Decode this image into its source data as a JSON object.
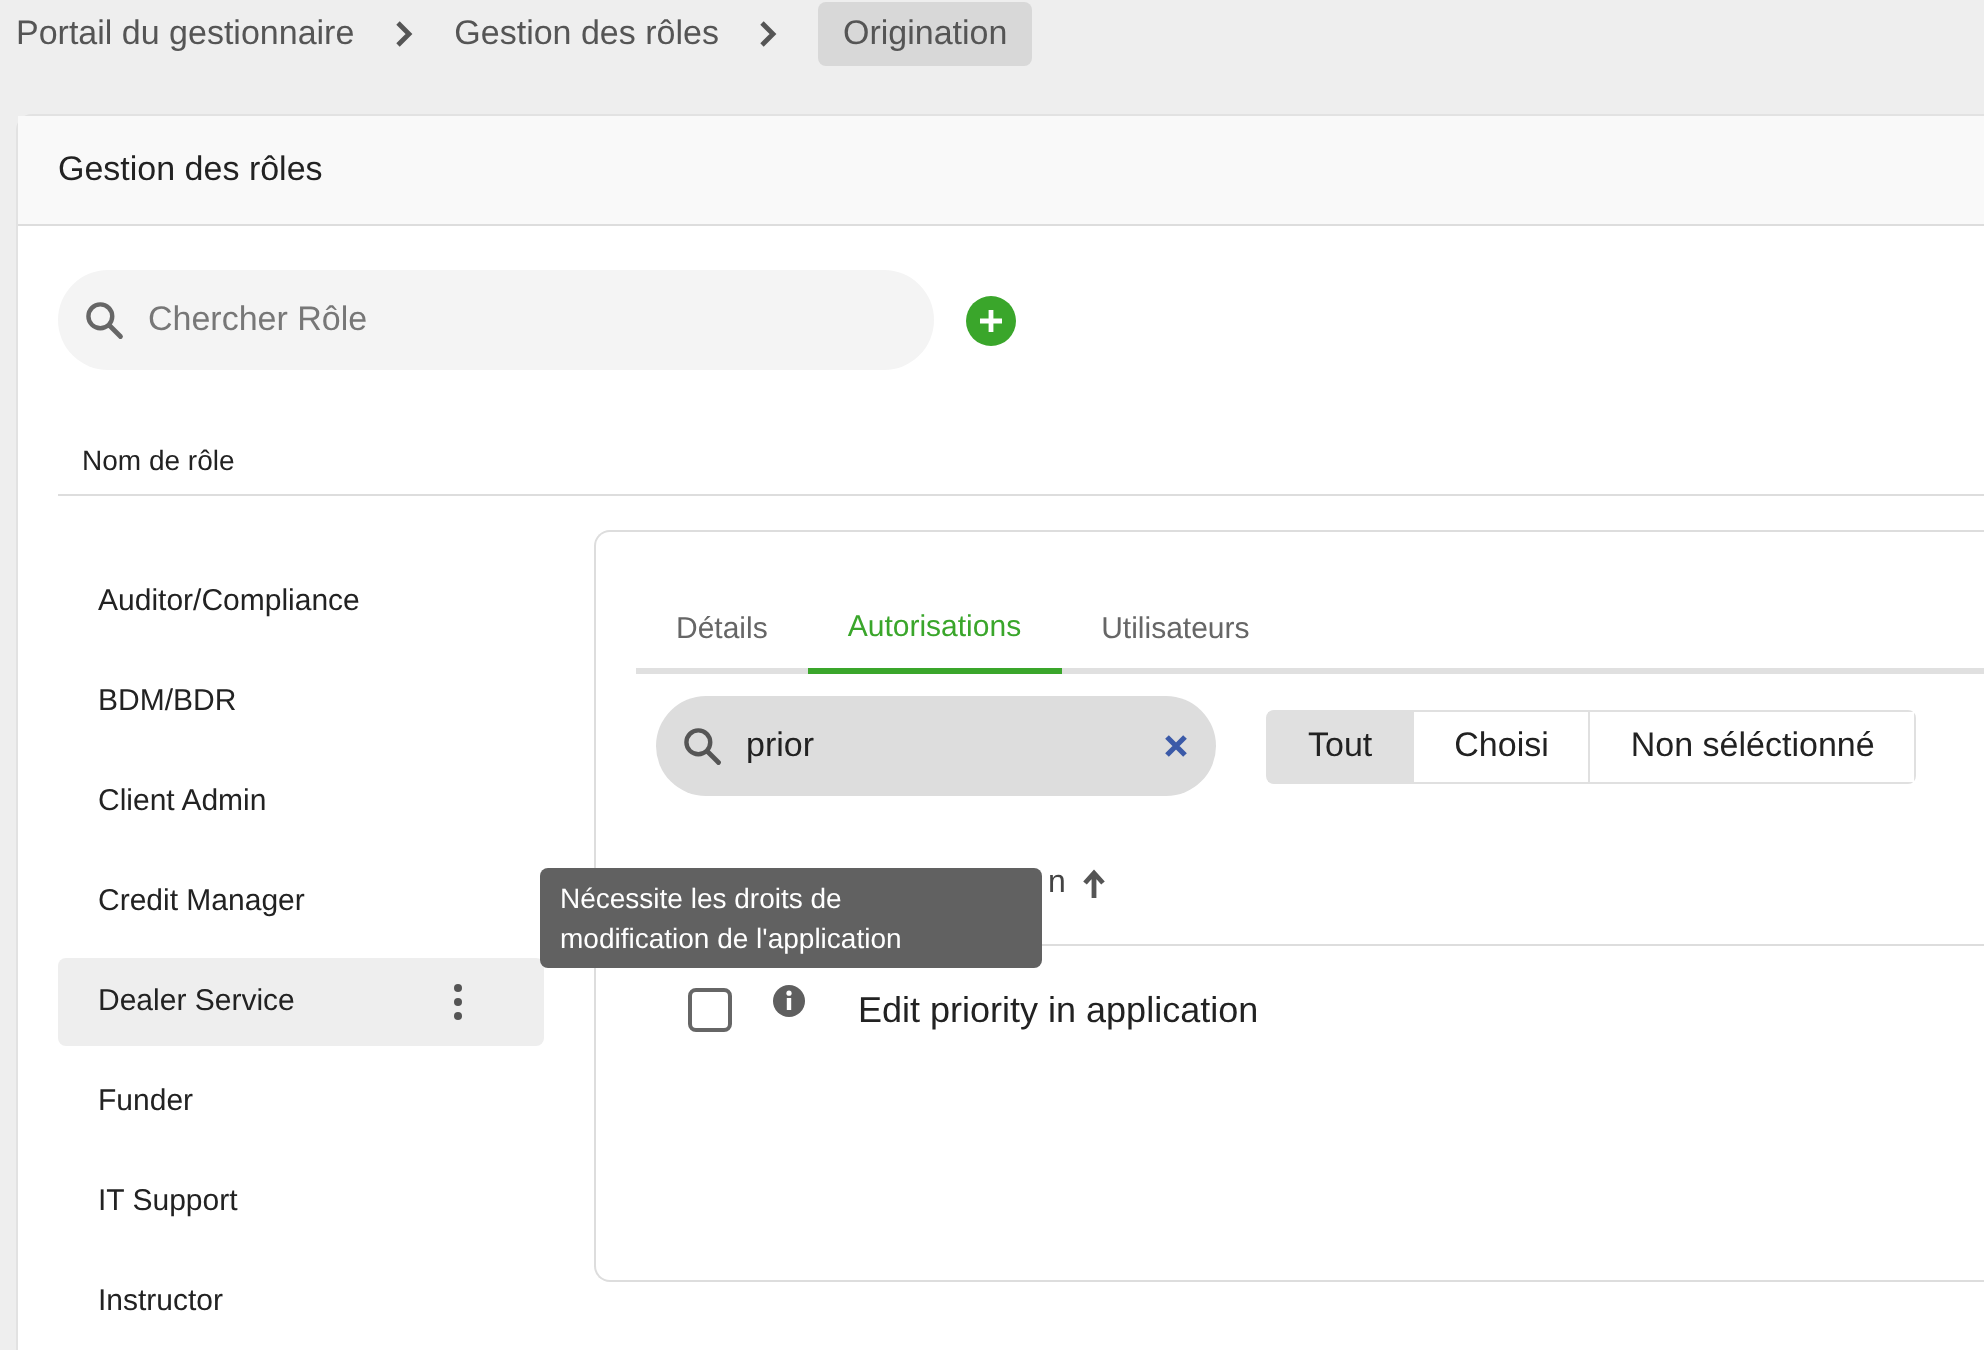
{
  "breadcrumb": [
    {
      "label": "Portail du gestionnaire",
      "selected": false
    },
    {
      "label": "Gestion des rôles",
      "selected": false
    },
    {
      "label": "Origination",
      "selected": true
    }
  ],
  "card": {
    "title": "Gestion des rôles"
  },
  "role_search": {
    "placeholder": "Chercher Rôle"
  },
  "roles_header": "Nom de rôle",
  "roles": [
    {
      "label": "Auditor/Compliance",
      "selected": false
    },
    {
      "label": "BDM/BDR",
      "selected": false
    },
    {
      "label": "Client Admin",
      "selected": false
    },
    {
      "label": "Credit Manager",
      "selected": false
    },
    {
      "label": "Dealer Service",
      "selected": true
    },
    {
      "label": "Funder",
      "selected": false
    },
    {
      "label": "IT Support",
      "selected": false
    },
    {
      "label": "Instructor",
      "selected": false
    }
  ],
  "tabs": [
    {
      "label": "Détails",
      "selected": false
    },
    {
      "label": "Autorisations",
      "selected": true
    },
    {
      "label": "Utilisateurs",
      "selected": false
    }
  ],
  "permission_search": {
    "value": "prior"
  },
  "filter": [
    {
      "label": "Tout",
      "selected": true
    },
    {
      "label": "Choisi",
      "selected": false
    },
    {
      "label": "Non séléctionné",
      "selected": false
    }
  ],
  "column_header": "n",
  "permissions": [
    {
      "label": "Edit priority in application",
      "checked": false
    }
  ],
  "tooltip": "Nécessite les droits de modification de l'application"
}
